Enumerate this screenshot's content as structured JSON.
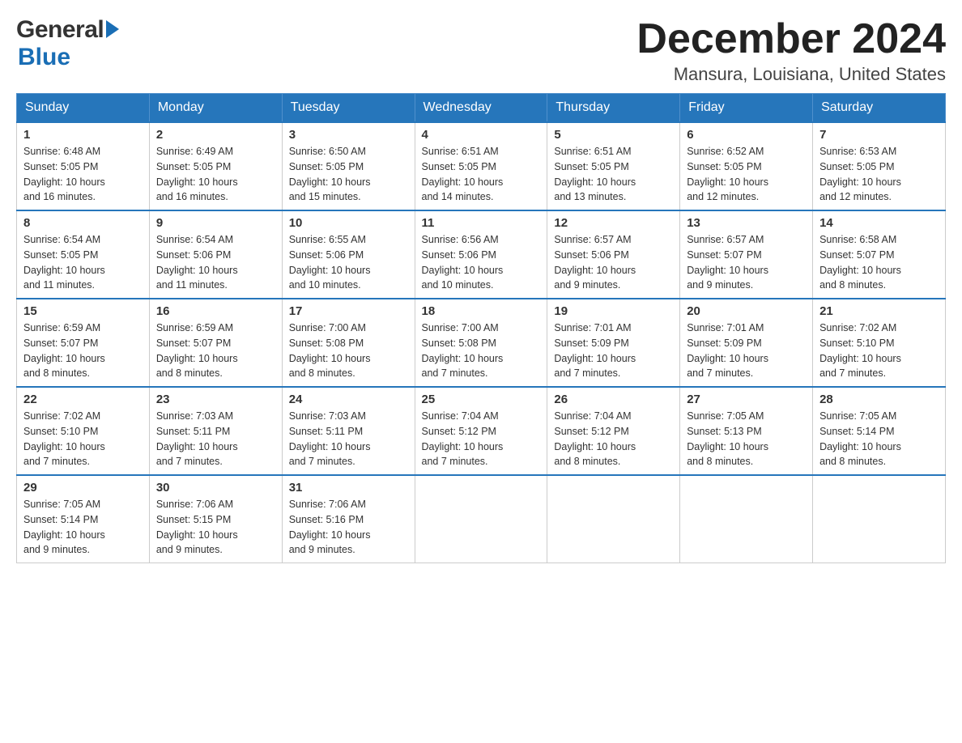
{
  "header": {
    "logo_general": "General",
    "logo_blue": "Blue",
    "month_title": "December 2024",
    "location": "Mansura, Louisiana, United States"
  },
  "days_of_week": [
    "Sunday",
    "Monday",
    "Tuesday",
    "Wednesday",
    "Thursday",
    "Friday",
    "Saturday"
  ],
  "weeks": [
    [
      {
        "day": "1",
        "sunrise": "6:48 AM",
        "sunset": "5:05 PM",
        "daylight": "10 hours and 16 minutes."
      },
      {
        "day": "2",
        "sunrise": "6:49 AM",
        "sunset": "5:05 PM",
        "daylight": "10 hours and 16 minutes."
      },
      {
        "day": "3",
        "sunrise": "6:50 AM",
        "sunset": "5:05 PM",
        "daylight": "10 hours and 15 minutes."
      },
      {
        "day": "4",
        "sunrise": "6:51 AM",
        "sunset": "5:05 PM",
        "daylight": "10 hours and 14 minutes."
      },
      {
        "day": "5",
        "sunrise": "6:51 AM",
        "sunset": "5:05 PM",
        "daylight": "10 hours and 13 minutes."
      },
      {
        "day": "6",
        "sunrise": "6:52 AM",
        "sunset": "5:05 PM",
        "daylight": "10 hours and 12 minutes."
      },
      {
        "day": "7",
        "sunrise": "6:53 AM",
        "sunset": "5:05 PM",
        "daylight": "10 hours and 12 minutes."
      }
    ],
    [
      {
        "day": "8",
        "sunrise": "6:54 AM",
        "sunset": "5:05 PM",
        "daylight": "10 hours and 11 minutes."
      },
      {
        "day": "9",
        "sunrise": "6:54 AM",
        "sunset": "5:06 PM",
        "daylight": "10 hours and 11 minutes."
      },
      {
        "day": "10",
        "sunrise": "6:55 AM",
        "sunset": "5:06 PM",
        "daylight": "10 hours and 10 minutes."
      },
      {
        "day": "11",
        "sunrise": "6:56 AM",
        "sunset": "5:06 PM",
        "daylight": "10 hours and 10 minutes."
      },
      {
        "day": "12",
        "sunrise": "6:57 AM",
        "sunset": "5:06 PM",
        "daylight": "10 hours and 9 minutes."
      },
      {
        "day": "13",
        "sunrise": "6:57 AM",
        "sunset": "5:07 PM",
        "daylight": "10 hours and 9 minutes."
      },
      {
        "day": "14",
        "sunrise": "6:58 AM",
        "sunset": "5:07 PM",
        "daylight": "10 hours and 8 minutes."
      }
    ],
    [
      {
        "day": "15",
        "sunrise": "6:59 AM",
        "sunset": "5:07 PM",
        "daylight": "10 hours and 8 minutes."
      },
      {
        "day": "16",
        "sunrise": "6:59 AM",
        "sunset": "5:07 PM",
        "daylight": "10 hours and 8 minutes."
      },
      {
        "day": "17",
        "sunrise": "7:00 AM",
        "sunset": "5:08 PM",
        "daylight": "10 hours and 8 minutes."
      },
      {
        "day": "18",
        "sunrise": "7:00 AM",
        "sunset": "5:08 PM",
        "daylight": "10 hours and 7 minutes."
      },
      {
        "day": "19",
        "sunrise": "7:01 AM",
        "sunset": "5:09 PM",
        "daylight": "10 hours and 7 minutes."
      },
      {
        "day": "20",
        "sunrise": "7:01 AM",
        "sunset": "5:09 PM",
        "daylight": "10 hours and 7 minutes."
      },
      {
        "day": "21",
        "sunrise": "7:02 AM",
        "sunset": "5:10 PM",
        "daylight": "10 hours and 7 minutes."
      }
    ],
    [
      {
        "day": "22",
        "sunrise": "7:02 AM",
        "sunset": "5:10 PM",
        "daylight": "10 hours and 7 minutes."
      },
      {
        "day": "23",
        "sunrise": "7:03 AM",
        "sunset": "5:11 PM",
        "daylight": "10 hours and 7 minutes."
      },
      {
        "day": "24",
        "sunrise": "7:03 AM",
        "sunset": "5:11 PM",
        "daylight": "10 hours and 7 minutes."
      },
      {
        "day": "25",
        "sunrise": "7:04 AM",
        "sunset": "5:12 PM",
        "daylight": "10 hours and 7 minutes."
      },
      {
        "day": "26",
        "sunrise": "7:04 AM",
        "sunset": "5:12 PM",
        "daylight": "10 hours and 8 minutes."
      },
      {
        "day": "27",
        "sunrise": "7:05 AM",
        "sunset": "5:13 PM",
        "daylight": "10 hours and 8 minutes."
      },
      {
        "day": "28",
        "sunrise": "7:05 AM",
        "sunset": "5:14 PM",
        "daylight": "10 hours and 8 minutes."
      }
    ],
    [
      {
        "day": "29",
        "sunrise": "7:05 AM",
        "sunset": "5:14 PM",
        "daylight": "10 hours and 9 minutes."
      },
      {
        "day": "30",
        "sunrise": "7:06 AM",
        "sunset": "5:15 PM",
        "daylight": "10 hours and 9 minutes."
      },
      {
        "day": "31",
        "sunrise": "7:06 AM",
        "sunset": "5:16 PM",
        "daylight": "10 hours and 9 minutes."
      },
      null,
      null,
      null,
      null
    ]
  ],
  "labels": {
    "sunrise": "Sunrise:",
    "sunset": "Sunset:",
    "daylight": "Daylight:"
  }
}
